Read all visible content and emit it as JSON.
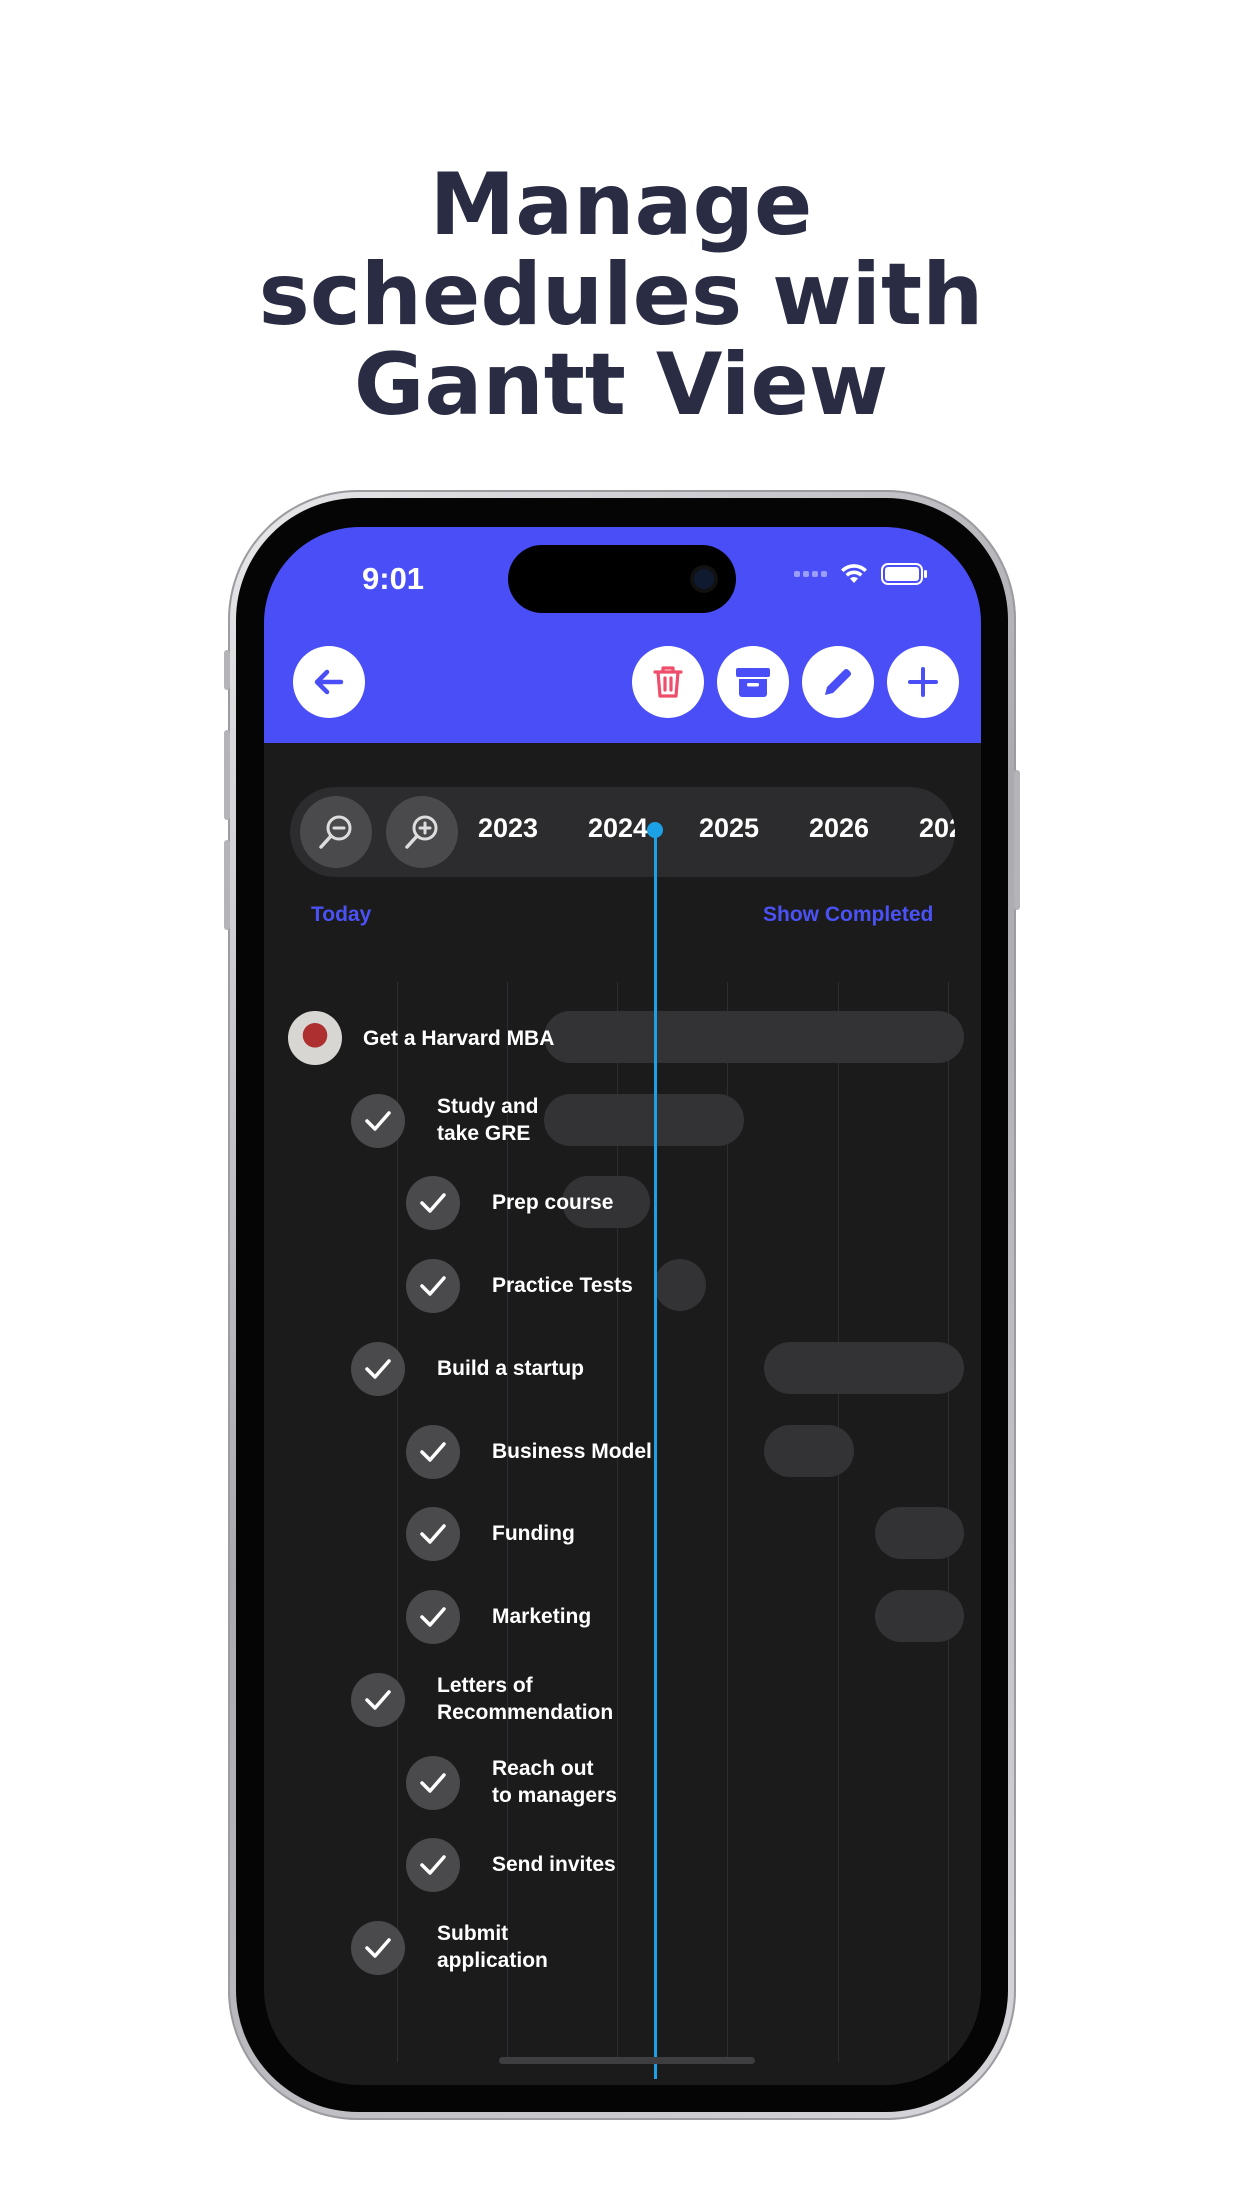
{
  "headline": {
    "line1": "Manage",
    "line2": "schedules with",
    "line3": "Gantt View"
  },
  "status_bar": {
    "time": "9:01"
  },
  "toolbar": {
    "back": "arrow-left-icon",
    "delete": "trash-icon",
    "archive": "archive-icon",
    "edit": "pencil-icon",
    "add": "plus-icon",
    "accent_color": "#4a4ef7",
    "delete_color": "#ef4d6c"
  },
  "timeline": {
    "zoom_out": "zoom-out-icon",
    "zoom_in": "zoom-in-icon",
    "years": [
      "2023",
      "2024",
      "2025",
      "2026",
      "202"
    ],
    "today_link": "Today",
    "show_completed_link": "Show Completed",
    "today_line_color": "#1da1e6"
  },
  "tasks": [
    {
      "label": "Get a Harvard MBA",
      "level": 0
    },
    {
      "label": "Study and\ntake GRE",
      "level": 1
    },
    {
      "label": "Prep course",
      "level": 2
    },
    {
      "label": "Practice Tests",
      "level": 2
    },
    {
      "label": "Build a startup",
      "level": 1
    },
    {
      "label": "Business Model",
      "level": 2
    },
    {
      "label": "Funding",
      "level": 2
    },
    {
      "label": "Marketing",
      "level": 2
    },
    {
      "label": "Letters of\nRecommendation",
      "level": 1
    },
    {
      "label": "Reach out\nto managers",
      "level": 2
    },
    {
      "label": "Send invites",
      "level": 2
    },
    {
      "label": "Submit\napplication",
      "level": 1
    }
  ]
}
